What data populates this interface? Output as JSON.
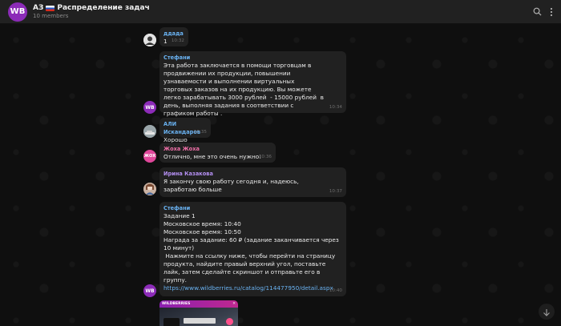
{
  "header": {
    "avatar_text": "WB",
    "title_prefix": "АЗ",
    "title": "Распределение задач",
    "members": "10 members",
    "icons": [
      "search-icon",
      "more-vertical-icon"
    ]
  },
  "messages": [
    {
      "sender": "ддада",
      "text": "1",
      "time": "10:32"
    },
    {
      "sender": "Стефани",
      "text": "Эта работа заключается в помощи торговцам в продвижении их продукции, повышении узнаваемости и выполнении виртуальных торговых заказов на их продукцию. Вы можете легко зарабатывать 3000 рублей  - 15000 рублей  в день, выполняя задания в соответствии с графиком работы .",
      "time": "10:34"
    },
    {
      "sender": "АЛИ Искандаров",
      "text": "Хорошо",
      "time": "10:35"
    },
    {
      "sender": "Жоха Жоха",
      "text": "Отлично, мне это очень нужно!",
      "time": "10:36"
    },
    {
      "sender": "Ирина Казакова",
      "text": "Я закончу свою работу сегодня и, надеюсь, заработаю больше",
      "time": "10:37"
    },
    {
      "sender": "Стефани",
      "text": "Задание 1\nМосковское время: 10:40\nМосковское время: 10:50\nНаграда за задание: 60 ₽ (задание заканчивается через 10 минут)\n Нажмите на ссылку ниже, чтобы перейти на страницу продукта, найдите правый верхний угол, поставьте лайк, затем сделайте скриншот и отправьте его в группу.",
      "link": "https://www.wildberries.ru/catalog/114477950/detail.aspx",
      "time": "10:40"
    }
  ],
  "avatars": {
    "wb": "WB",
    "zhoha": "ЖОХ"
  },
  "preview": {
    "brand": "WILDBERRIES"
  },
  "colors": {
    "accent": "#6ab3f3",
    "brand": "#8c2bb8",
    "bubble": "#212121",
    "background": "#0f0f0f"
  }
}
